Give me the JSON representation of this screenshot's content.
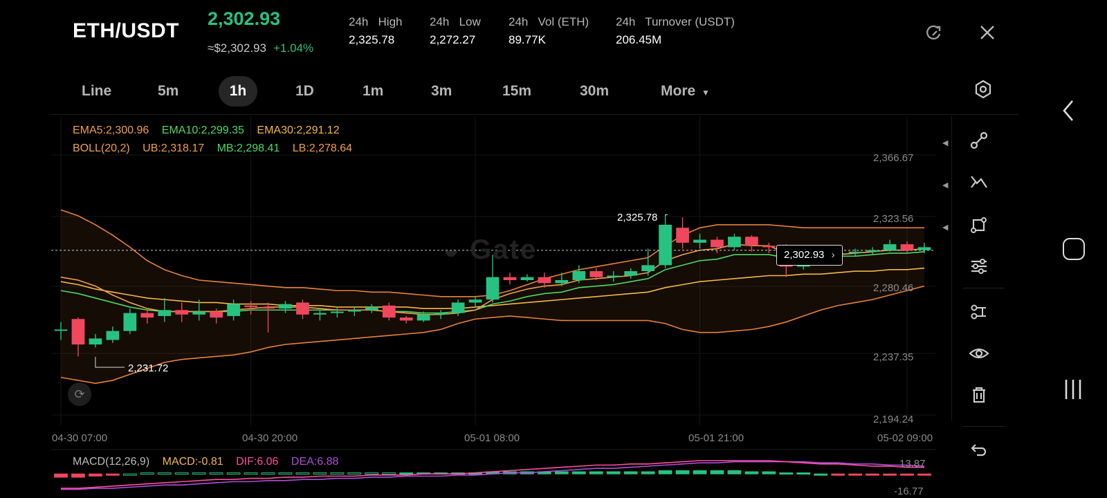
{
  "header": {
    "pair": "ETH/USDT",
    "last_price": "2,302.93",
    "fiat_price": "≈$2,302.93",
    "change": "+1.04%",
    "stats": [
      {
        "label": "24h   High",
        "value": "2,325.78"
      },
      {
        "label": "24h   Low",
        "value": "2,272.27"
      },
      {
        "label": "24h   Vol (ETH)",
        "value": "89.77K"
      },
      {
        "label": "24h   Turnover (USDT)",
        "value": "206.45M"
      }
    ]
  },
  "timeframes": [
    "Line",
    "5m",
    "1h",
    "1D",
    "1m",
    "3m",
    "15m",
    "30m",
    "More"
  ],
  "active_timeframe": "1h",
  "indicators": {
    "ema5": "EMA5:2,300.96",
    "ema10": "EMA10:2,299.35",
    "ema30": "EMA30:2,291.12",
    "boll": "BOLL(20,2)",
    "ub": "UB:2,318.17",
    "mb": "MB:2,298.41",
    "lb": "LB:2,278.64"
  },
  "y_axis": [
    "2,366.67",
    "2,323.56",
    "2,280.46",
    "2,237.35",
    "2,194.24"
  ],
  "x_axis": [
    "04-30 07:00",
    "04-30 20:00",
    "05-01 08:00",
    "05-01 21:00",
    "05-02 09:00"
  ],
  "high_marker": "2,325.78",
  "low_marker": "2,231.72",
  "current_price_tag": "2,302.93",
  "macd": {
    "title": "MACD(12,26,9)",
    "macd": "MACD:-0.81",
    "dif": "DIF:6.06",
    "dea": "DEA:6.88",
    "ymax": "13.87",
    "ymin": "-16.77"
  },
  "colors": {
    "up": "#27c281",
    "down": "#f0475d",
    "ema5": "#f0a04b",
    "ema10": "#4cd964",
    "ema30": "#f5b942",
    "boll": "#e8823a",
    "dif": "#ff4fa0",
    "dea": "#b04ddb"
  },
  "chart_data": {
    "type": "candlestick",
    "y_range": [
      2194.24,
      2366.67
    ],
    "candles": [
      [
        2250,
        2250,
        2243,
        2255
      ],
      [
        2257,
        2240,
        2232,
        2258
      ],
      [
        2240,
        2244,
        2238,
        2247
      ],
      [
        2243,
        2249,
        2241,
        2252
      ],
      [
        2249,
        2261,
        2247,
        2264
      ],
      [
        2261,
        2258,
        2254,
        2263
      ],
      [
        2259,
        2263,
        2255,
        2271
      ],
      [
        2263,
        2260,
        2255,
        2268
      ],
      [
        2260,
        2262,
        2256,
        2270
      ],
      [
        2262,
        2258,
        2254,
        2264
      ],
      [
        2259,
        2267,
        2256,
        2270
      ],
      [
        2266,
        2265,
        2260,
        2269
      ],
      [
        2265,
        2264,
        2248,
        2268
      ],
      [
        2264,
        2267,
        2261,
        2269
      ],
      [
        2268,
        2260,
        2257,
        2270
      ],
      [
        2260,
        2261,
        2256,
        2263
      ],
      [
        2261,
        2262,
        2258,
        2265
      ],
      [
        2262,
        2263,
        2259,
        2265
      ],
      [
        2263,
        2265,
        2261,
        2267
      ],
      [
        2266,
        2258,
        2256,
        2268
      ],
      [
        2258,
        2256,
        2254,
        2259
      ],
      [
        2256,
        2260,
        2255,
        2262
      ],
      [
        2260,
        2261,
        2257,
        2263
      ],
      [
        2261,
        2268,
        2259,
        2270
      ],
      [
        2268,
        2270,
        2265,
        2272
      ],
      [
        2270,
        2285,
        2268,
        2300
      ],
      [
        2285,
        2283,
        2280,
        2288
      ],
      [
        2283,
        2285,
        2282,
        2287
      ],
      [
        2285,
        2281,
        2278,
        2288
      ],
      [
        2281,
        2283,
        2279,
        2288
      ],
      [
        2283,
        2289,
        2281,
        2293
      ],
      [
        2289,
        2285,
        2283,
        2291
      ],
      [
        2285,
        2286,
        2282,
        2289
      ],
      [
        2286,
        2289,
        2284,
        2291
      ],
      [
        2289,
        2293,
        2286,
        2304
      ],
      [
        2293,
        2320,
        2291,
        2325.78
      ],
      [
        2318,
        2308,
        2304,
        2325
      ],
      [
        2308,
        2310,
        2304,
        2314
      ],
      [
        2310,
        2305,
        2301,
        2312
      ],
      [
        2305,
        2312,
        2303,
        2314
      ],
      [
        2312,
        2306,
        2302,
        2313
      ],
      [
        2306,
        2305,
        2301,
        2308
      ],
      [
        2305,
        2292,
        2285,
        2307
      ],
      [
        2292,
        2299,
        2290,
        2302
      ],
      [
        2299,
        2300,
        2296,
        2302
      ],
      [
        2300,
        2301,
        2297,
        2303
      ],
      [
        2301,
        2302,
        2299,
        2304
      ],
      [
        2302,
        2303,
        2300,
        2305
      ],
      [
        2303,
        2307,
        2302,
        2310
      ],
      [
        2307,
        2303,
        2301,
        2309
      ],
      [
        2303,
        2305,
        2301,
        2308
      ]
    ],
    "upper_band": [
      2330,
      2326,
      2320,
      2313,
      2305,
      2296,
      2290,
      2286,
      2283,
      2282,
      2281,
      2280,
      2279,
      2278,
      2278,
      2277,
      2276,
      2276,
      2275,
      2275,
      2274,
      2273,
      2272,
      2272,
      2272,
      2273,
      2276,
      2280,
      2284,
      2287,
      2290,
      2292,
      2294,
      2296,
      2298,
      2306,
      2313,
      2318,
      2320,
      2320,
      2320,
      2320,
      2319,
      2318,
      2318,
      2318,
      2318,
      2318,
      2318,
      2318,
      2318
    ],
    "lower_band": [
      2218,
      2216,
      2214,
      2216,
      2220,
      2224,
      2228,
      2230,
      2231,
      2232,
      2233,
      2235,
      2238,
      2240,
      2241,
      2242,
      2243,
      2244,
      2245,
      2246,
      2247,
      2248,
      2250,
      2254,
      2257,
      2258,
      2259,
      2258,
      2257,
      2256,
      2256,
      2256,
      2256,
      2256,
      2256,
      2254,
      2250,
      2248,
      2248,
      2249,
      2250,
      2252,
      2255,
      2259,
      2263,
      2266,
      2268,
      2270,
      2273,
      2276,
      2279
    ],
    "ema5": [
      2285,
      2283,
      2279,
      2273,
      2268,
      2264,
      2262,
      2262,
      2262,
      2262,
      2263,
      2264,
      2265,
      2265,
      2265,
      2264,
      2263,
      2263,
      2263,
      2262,
      2261,
      2260,
      2260,
      2261,
      2263,
      2270,
      2274,
      2277,
      2279,
      2280,
      2283,
      2284,
      2285,
      2286,
      2288,
      2296,
      2300,
      2303,
      2304,
      2307,
      2306,
      2306,
      2301,
      2300,
      2300,
      2300,
      2301,
      2302,
      2303,
      2303,
      2304
    ],
    "ema10": [
      2276,
      2274,
      2271,
      2268,
      2265,
      2263,
      2262,
      2262,
      2262,
      2262,
      2262,
      2263,
      2263,
      2263,
      2263,
      2263,
      2263,
      2263,
      2263,
      2262,
      2262,
      2261,
      2261,
      2262,
      2263,
      2267,
      2269,
      2272,
      2274,
      2275,
      2278,
      2279,
      2280,
      2282,
      2284,
      2290,
      2293,
      2296,
      2297,
      2300,
      2300,
      2300,
      2298,
      2298,
      2298,
      2299,
      2299,
      2300,
      2301,
      2301,
      2302
    ],
    "ema30": [
      2282,
      2280,
      2277,
      2275,
      2273,
      2271,
      2270,
      2269,
      2268,
      2268,
      2267,
      2267,
      2267,
      2266,
      2266,
      2266,
      2265,
      2265,
      2265,
      2265,
      2265,
      2264,
      2264,
      2264,
      2265,
      2266,
      2267,
      2268,
      2269,
      2270,
      2271,
      2272,
      2273,
      2274,
      2275,
      2278,
      2280,
      2282,
      2283,
      2284,
      2285,
      2286,
      2286,
      2287,
      2287,
      2288,
      2289,
      2289,
      2290,
      2290,
      2291
    ],
    "macd_hist": [
      -3,
      -3,
      -2,
      -1,
      0,
      1,
      1,
      1,
      1,
      1,
      1,
      1,
      1,
      1,
      1,
      1,
      1,
      1,
      1,
      1,
      1,
      1,
      1,
      1,
      1,
      2,
      2,
      2,
      2,
      2,
      2,
      2,
      2,
      2,
      2,
      3,
      3,
      3,
      3,
      3,
      2,
      2,
      1,
      1,
      0,
      -1,
      -1,
      -1,
      -1,
      -1,
      -1
    ],
    "dif": [
      -13,
      -13,
      -12,
      -11,
      -10,
      -9,
      -8,
      -7,
      -6,
      -5,
      -5,
      -4,
      -4,
      -3,
      -3,
      -2,
      -2,
      -2,
      -1,
      -1,
      -1,
      0,
      0,
      0,
      1,
      2,
      3,
      4,
      5,
      6,
      7,
      8,
      8,
      9,
      9,
      10,
      11,
      12,
      12,
      12,
      12,
      12,
      11,
      10,
      9,
      9,
      8,
      7,
      7,
      6,
      6
    ],
    "dea": [
      -14,
      -14,
      -13,
      -13,
      -12,
      -11,
      -10,
      -10,
      -9,
      -8,
      -7,
      -7,
      -6,
      -6,
      -5,
      -5,
      -4,
      -4,
      -3,
      -3,
      -2,
      -2,
      -2,
      -1,
      -1,
      0,
      1,
      1,
      2,
      3,
      4,
      5,
      5,
      6,
      7,
      8,
      9,
      10,
      10,
      11,
      11,
      11,
      11,
      11,
      10,
      10,
      9,
      9,
      8,
      8,
      7
    ],
    "macd_range": [
      -16.77,
      13.87
    ]
  }
}
